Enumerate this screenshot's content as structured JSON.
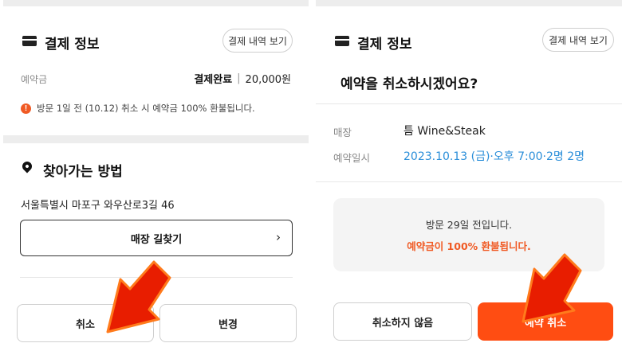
{
  "left": {
    "payment_title": "결제 정보",
    "payment_history_button": "결제 내역 보기",
    "deposit_label": "예약금",
    "payment_status": "결제완료",
    "payment_separator": "|",
    "payment_amount": "20,000원",
    "refund_notice": "방문 1일 전 (10.12) 취소 시 예약금 100% 환불됩니다.",
    "directions_title": "찾아가는 방법",
    "address": "서울특별시 마포구 와우산로3길 46",
    "find_route_button": "매장 길찾기",
    "cancel_button": "취소",
    "change_button": "변경"
  },
  "right": {
    "payment_title": "결제 정보",
    "payment_history_button": "결제 내역 보기",
    "dialog_title": "예약을 취소하시겠어요?",
    "store_label": "매장",
    "store_name": "틈 Wine&Steak",
    "reservation_label": "예약일시",
    "reservation_value": "2023.10.13 (금)·오후 7:00·2명 2명",
    "refund_line1": "방문 29일 전입니다.",
    "refund_line2": "예약금이 100% 환불됩니다.",
    "keep_button": "취소하지 않음",
    "confirm_cancel_button": "예약 취소"
  },
  "colors": {
    "accent": "#ff4d12",
    "highlight_blue": "#2a8ed9",
    "notice_orange": "#f05a24",
    "arrow_red": "#e81d00",
    "arrow_outline": "#ff7b1c"
  },
  "icons": {
    "payment": "card-icon",
    "notice": "info-icon",
    "directions": "map-pin-icon",
    "route": "chevron-right-icon",
    "annotation": "red-arrow-icon"
  }
}
